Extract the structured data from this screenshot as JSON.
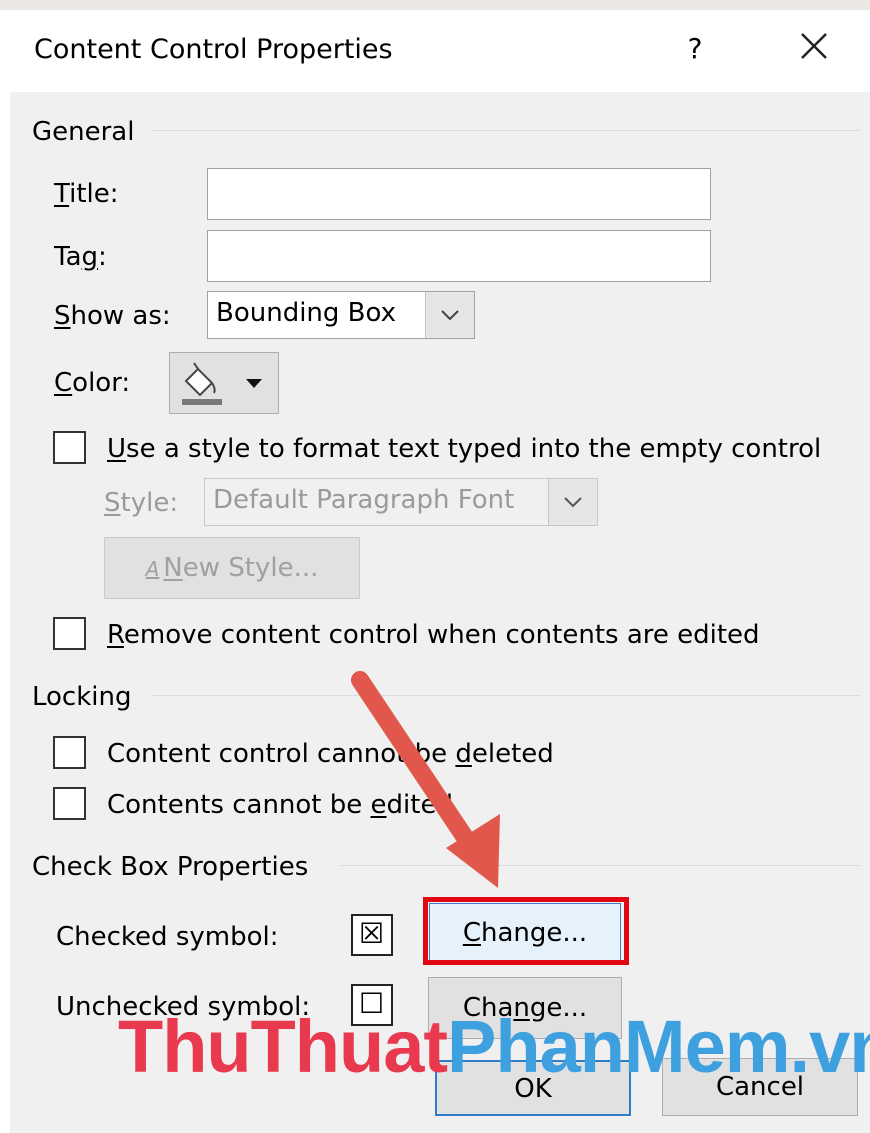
{
  "dialog": {
    "title": "Content Control Properties",
    "help_glyph": "?",
    "close_glyph": "✕"
  },
  "general": {
    "heading": "General",
    "title_label_u": "T",
    "title_label_rest": "itle:",
    "title_value": "",
    "tag_label_pre": "Ta",
    "tag_label_u": "g",
    "tag_label_rest": ":",
    "tag_value": "",
    "showas_label_u": "S",
    "showas_label_rest": "how as:",
    "showas_value": "Bounding Box",
    "color_label_u": "C",
    "color_label_rest": "olor:",
    "use_style_u": "U",
    "use_style_rest": "se a style to format text typed into the empty control",
    "style_label_u": "S",
    "style_label_rest": "tyle:",
    "style_value": "Default Paragraph Font",
    "new_style_icon": "A",
    "new_style_label_u": "N",
    "new_style_label_rest": "ew Style...",
    "remove_u": "R",
    "remove_rest": "emove content control when contents are edited"
  },
  "locking": {
    "heading": "Locking",
    "cannot_delete_pre": "Content control cannot be ",
    "cannot_delete_u": "d",
    "cannot_delete_rest": "eleted",
    "cannot_edit_pre": "Contents cannot be ",
    "cannot_edit_u": "e",
    "cannot_edit_rest": "dited"
  },
  "checkbox": {
    "heading": "Check Box Properties",
    "checked_label": "Checked symbol:",
    "checked_symbol": "☒",
    "change1_u": "C",
    "change1_rest": "hange...",
    "unchecked_label": "Unchecked symbol:",
    "unchecked_symbol": "☐",
    "change2_pre": "Cha",
    "change2_u": "n",
    "change2_rest": "ge..."
  },
  "footer": {
    "ok": "OK",
    "cancel": "Cancel"
  },
  "watermark": {
    "part1": "ThuThuat",
    "part2": "PhanMem",
    "part3": ".vn"
  },
  "colors": {
    "highlight": "#e30613",
    "arrow": "#e2574c",
    "wm_red": "#e8394f",
    "wm_blue": "#3fa0e0",
    "focus": "#3c7fc6"
  }
}
